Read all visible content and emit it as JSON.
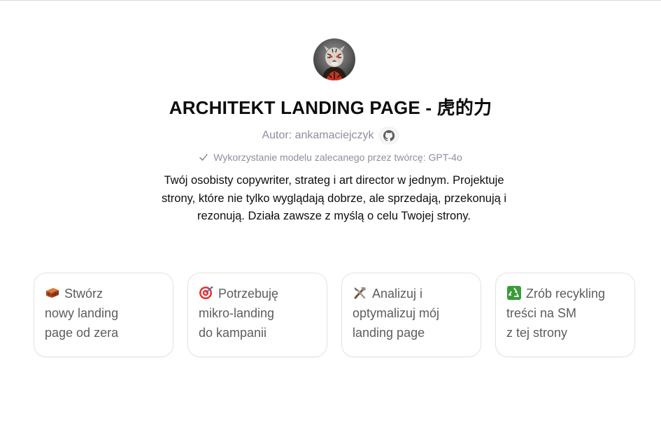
{
  "gpt": {
    "title": "ARCHITEKT LANDING PAGE - 虎的力",
    "author_label": "Autor: ankamaciejczyk",
    "model_note": "Wykorzystanie modelu zalecanego przez twórcę: GPT-4o",
    "description": "Twój osobisty copywriter, strateg i art director w jednym. Projektuje strony, które nie tylko wyglądają dobrze, ale sprzedają, przekonują i rezonują. Działa zawsze z myślą o celu Twojej strony.",
    "avatar_icon": "tiger-avatar-icon",
    "github_icon": "github-icon",
    "check_icon": "checkmark-icon"
  },
  "starters": [
    {
      "icon": "brick-icon",
      "line1": "Stwórz",
      "rest": "nowy landing\npage od zera"
    },
    {
      "icon": "target-icon",
      "line1": "Potrzebuję",
      "rest": "mikro-landing\ndo kampanii"
    },
    {
      "icon": "tools-icon",
      "line1": "Analizuj i",
      "rest": "optymalizuj mój\nlanding page"
    },
    {
      "icon": "recycle-icon",
      "line1": "Zrób recykling",
      "rest": "treści na SM\nz tej strony"
    }
  ],
  "colors": {
    "muted_text": "#8e8ea0",
    "card_border": "#e3e3e3",
    "card_text": "#5d5d5d"
  }
}
